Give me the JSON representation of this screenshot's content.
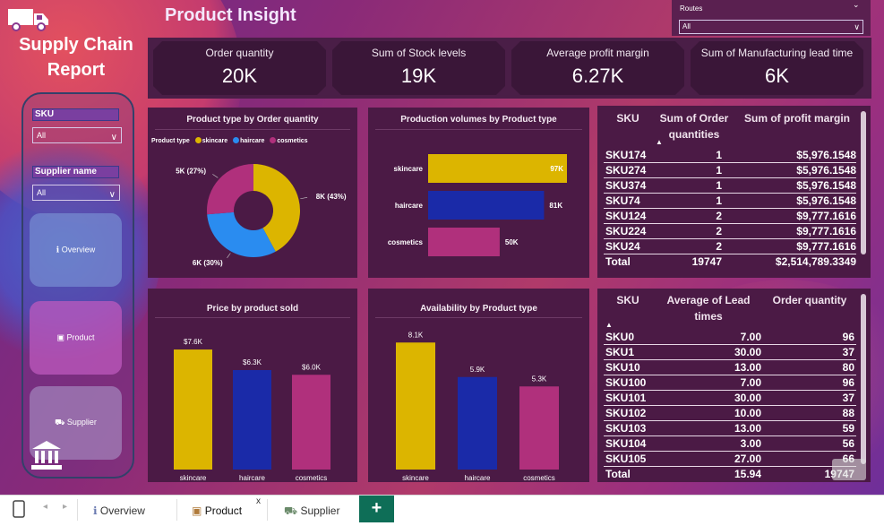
{
  "app": {
    "report_title": "Supply Chain Report",
    "page_title": "Product Insight",
    "colors": {
      "skincare": "#dcb500",
      "haircare": "#1a2aa8",
      "cosmetics": "#b0307c",
      "card_bg": "#4b1a45"
    }
  },
  "routes_slicer": {
    "label": "Routes",
    "value": "All"
  },
  "sidebar": {
    "sku_slicer": {
      "label": "SKU",
      "value": "All"
    },
    "supplier_slicer": {
      "label": "Supplier name",
      "value": "All"
    },
    "nav": [
      {
        "label": "Overview",
        "icon": "info-icon"
      },
      {
        "label": "Product",
        "icon": "box-icon"
      },
      {
        "label": "Supplier",
        "icon": "truck-icon"
      }
    ]
  },
  "kpis": [
    {
      "label": "Order quantity",
      "value": "20K"
    },
    {
      "label": "Sum of Stock levels",
      "value": "19K"
    },
    {
      "label": "Average profit margin",
      "value": "6.27K"
    },
    {
      "label": "Sum of Manufacturing lead time",
      "value": "6K"
    }
  ],
  "donut": {
    "title": "Product type by Order quantity",
    "legend_title": "Product type",
    "labels": [
      "8K (43%)",
      "6K (30%)",
      "5K (27%)"
    ]
  },
  "production": {
    "title": "Production volumes by Product type"
  },
  "price": {
    "title": "Price by product sold"
  },
  "availability": {
    "title": "Availability by Product type"
  },
  "chart_data": [
    {
      "type": "pie",
      "title": "Product type by Order quantity",
      "legend_title": "Product type",
      "categories": [
        "skincare",
        "haircare",
        "cosmetics"
      ],
      "values": [
        8000,
        6000,
        5000
      ],
      "percent": [
        43,
        30,
        27
      ],
      "data_labels": [
        "8K (43%)",
        "6K (30%)",
        "5K (27%)"
      ],
      "legend": "top-left"
    },
    {
      "type": "bar",
      "orientation": "horizontal",
      "title": "Production volumes by Product type",
      "categories": [
        "skincare",
        "haircare",
        "cosmetics"
      ],
      "values": [
        97000,
        81000,
        50000
      ],
      "data_labels": [
        "97K",
        "81K",
        "50K"
      ]
    },
    {
      "type": "bar",
      "title": "Price by product sold",
      "categories": [
        "skincare",
        "haircare",
        "cosmetics"
      ],
      "values": [
        7600,
        6300,
        6000
      ],
      "data_labels": [
        "$7.6K",
        "$6.3K",
        "$6.0K"
      ]
    },
    {
      "type": "bar",
      "title": "Availability by Product type",
      "categories": [
        "skincare",
        "haircare",
        "cosmetics"
      ],
      "values": [
        8100,
        5900,
        5300
      ],
      "data_labels": [
        "8.1K",
        "5.9K",
        "5.3K"
      ]
    }
  ],
  "table1": {
    "headers": [
      "SKU",
      "Sum of Order quantities",
      "Sum of profit margin"
    ],
    "rows": [
      [
        "SKU174",
        "1",
        "$5,976.1548"
      ],
      [
        "SKU274",
        "1",
        "$5,976.1548"
      ],
      [
        "SKU374",
        "1",
        "$5,976.1548"
      ],
      [
        "SKU74",
        "1",
        "$5,976.1548"
      ],
      [
        "SKU124",
        "2",
        "$9,777.1616"
      ],
      [
        "SKU224",
        "2",
        "$9,777.1616"
      ],
      [
        "SKU24",
        "2",
        "$9,777.1616"
      ]
    ],
    "total": [
      "Total",
      "19747",
      "$2,514,789.3349"
    ]
  },
  "table2": {
    "headers": [
      "SKU",
      "Average of Lead times",
      "Order quantity"
    ],
    "rows": [
      [
        "SKU0",
        "7.00",
        "96"
      ],
      [
        "SKU1",
        "30.00",
        "37"
      ],
      [
        "SKU10",
        "13.00",
        "80"
      ],
      [
        "SKU100",
        "7.00",
        "96"
      ],
      [
        "SKU101",
        "30.00",
        "37"
      ],
      [
        "SKU102",
        "10.00",
        "88"
      ],
      [
        "SKU103",
        "13.00",
        "59"
      ],
      [
        "SKU104",
        "3.00",
        "56"
      ],
      [
        "SKU105",
        "27.00",
        "66"
      ]
    ],
    "total": [
      "Total",
      "15.94",
      "19747"
    ]
  },
  "tabbar": {
    "tabs": [
      {
        "label": "Overview",
        "icon": "info-icon"
      },
      {
        "label": "Product",
        "icon": "box-icon",
        "active": true
      },
      {
        "label": "Supplier",
        "icon": "truck-icon"
      }
    ],
    "close": "x",
    "add": "+"
  }
}
